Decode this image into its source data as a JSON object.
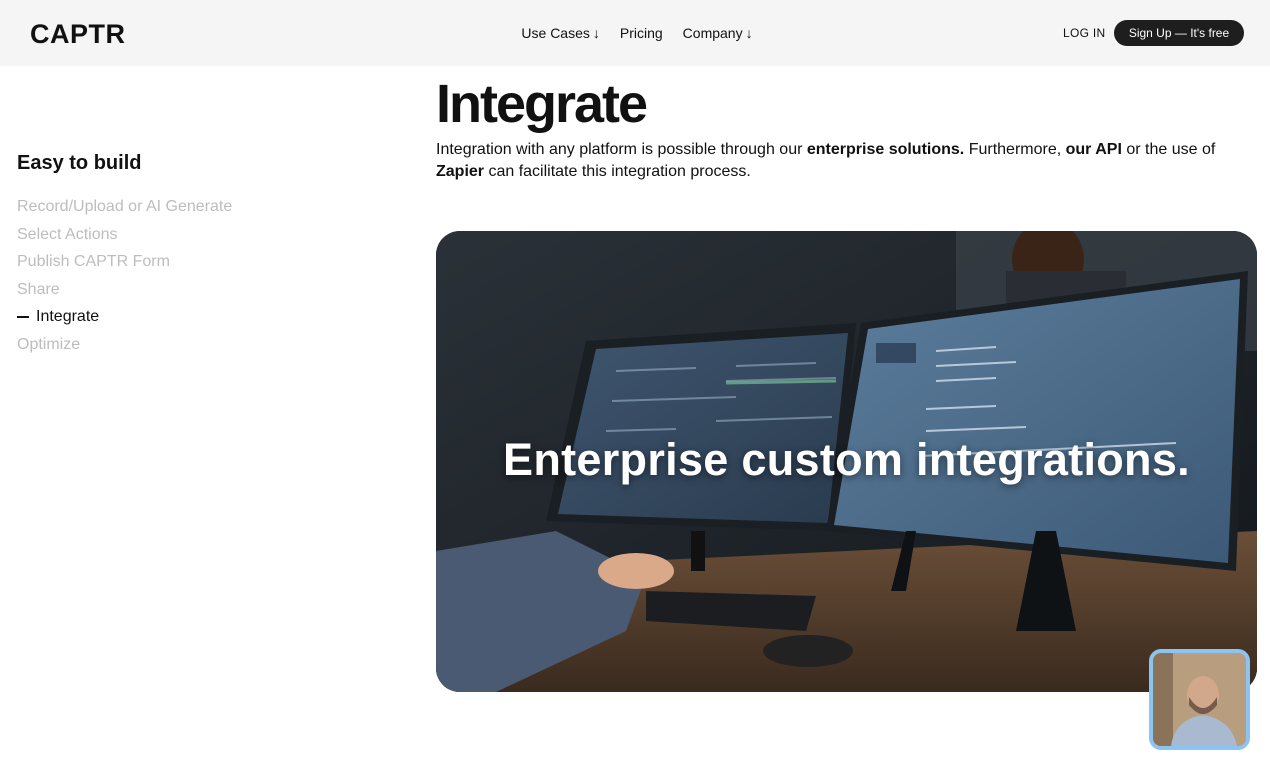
{
  "header": {
    "logo": "CAPTR",
    "nav": [
      {
        "label": "Use Cases",
        "arrow": "↓"
      },
      {
        "label": "Pricing",
        "arrow": ""
      },
      {
        "label": "Company",
        "arrow": "↓"
      }
    ],
    "login_label": "LOG IN",
    "signup_label": "Sign Up — It's free"
  },
  "sidebar": {
    "title": "Easy to build",
    "items": [
      {
        "label": "Record/Upload or AI Generate",
        "active": false
      },
      {
        "label": "Select Actions",
        "active": false
      },
      {
        "label": "Publish CAPTR Form",
        "active": false
      },
      {
        "label": "Share",
        "active": false
      },
      {
        "label": "Integrate",
        "active": true
      },
      {
        "label": "Optimize",
        "active": false
      }
    ]
  },
  "main": {
    "title": "Integrate",
    "description": {
      "p1": "Integration with any platform is possible through our ",
      "b1": "enterprise solutions.",
      "p2": " Furthermore, ",
      "b2": "our API",
      "p3": " or the use of ",
      "b3": "Zapier",
      "p4": " can facilitate this integration process."
    },
    "hero_caption": "Enterprise custom integrations."
  },
  "colors": {
    "header_bg": "#f5f5f5",
    "signup_bg": "#1e1e1e",
    "inactive_text": "#bdbdbd",
    "video_border": "#8bc3f3"
  }
}
